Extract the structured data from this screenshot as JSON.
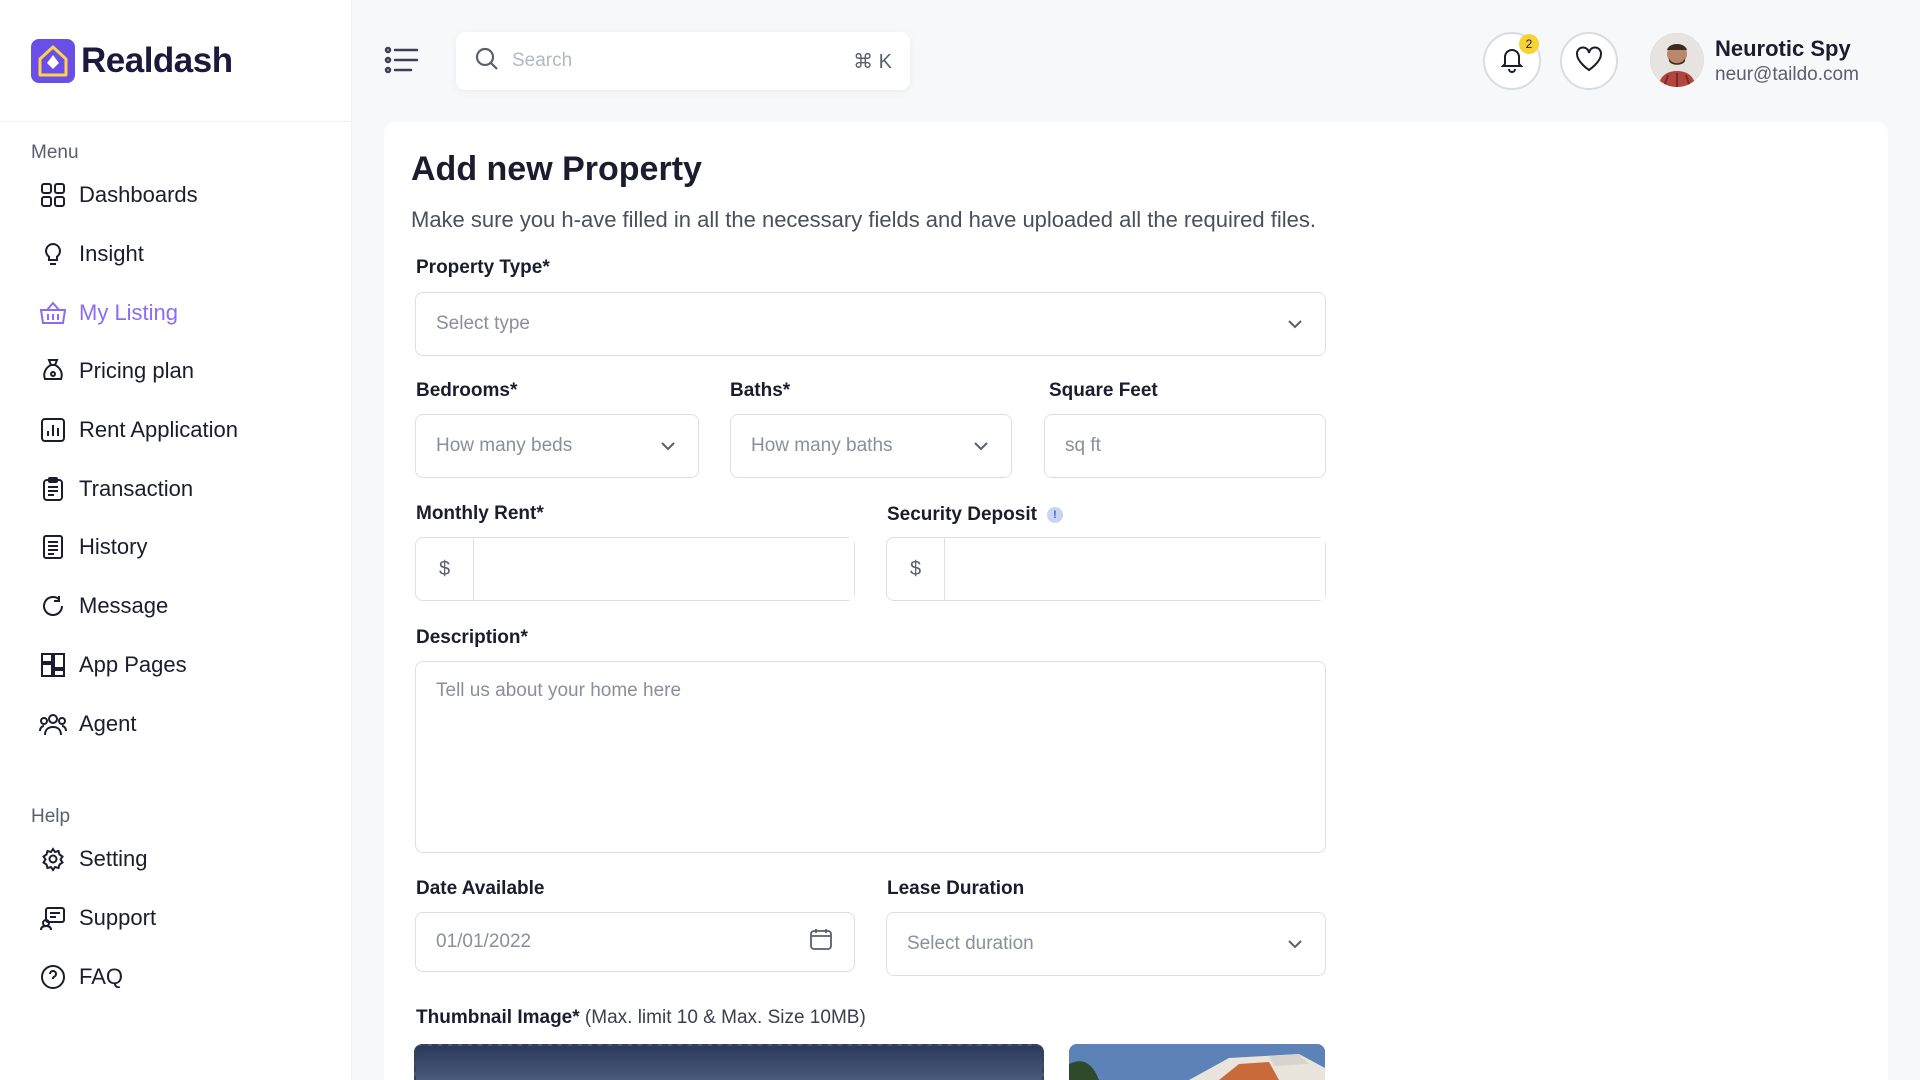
{
  "brand": {
    "name": "Realdash"
  },
  "sidebar": {
    "menu_title": "Menu",
    "items": [
      {
        "label": "Dashboards",
        "icon": "grid-icon"
      },
      {
        "label": "Insight",
        "icon": "lightbulb-icon"
      },
      {
        "label": "My Listing",
        "icon": "basket-icon",
        "active": true
      },
      {
        "label": "Pricing plan",
        "icon": "money-bag-icon"
      },
      {
        "label": "Rent Application",
        "icon": "bar-chart-icon"
      },
      {
        "label": "Transaction",
        "icon": "clipboard-icon"
      },
      {
        "label": "History",
        "icon": "document-icon"
      },
      {
        "label": "Message",
        "icon": "chat-icon"
      },
      {
        "label": "App Pages",
        "icon": "layout-icon"
      },
      {
        "label": "Agent",
        "icon": "users-icon"
      }
    ],
    "help_title": "Help",
    "help_items": [
      {
        "label": "Setting",
        "icon": "gear-icon"
      },
      {
        "label": "Support",
        "icon": "support-icon"
      },
      {
        "label": "FAQ",
        "icon": "question-icon"
      }
    ]
  },
  "topbar": {
    "search_placeholder": "Search",
    "shortcut": "⌘ K",
    "notification_count": "2",
    "user": {
      "name": "Neurotic Spy",
      "email": "neur@taildo.com"
    }
  },
  "form": {
    "title": "Add new Property",
    "subtitle": "Make sure you h-ave filled in all the necessary fields and have uploaded all the required files.",
    "property_type": {
      "label": "Property Type*",
      "placeholder": "Select type"
    },
    "bedrooms": {
      "label": "Bedrooms*",
      "placeholder": "How many beds"
    },
    "baths": {
      "label": "Baths*",
      "placeholder": "How many baths"
    },
    "square_feet": {
      "label": "Square Feet",
      "placeholder": "sq ft"
    },
    "monthly_rent": {
      "label": "Monthly Rent*",
      "currency": "$"
    },
    "security_deposit": {
      "label": "Security Deposit",
      "currency": "$",
      "info": "!"
    },
    "description": {
      "label": "Description*",
      "placeholder": "Tell us about your home here"
    },
    "date_available": {
      "label": "Date Available",
      "value": "01/01/2022"
    },
    "lease_duration": {
      "label": "Lease Duration",
      "placeholder": "Select duration"
    },
    "thumbnail": {
      "label": "Thumbnail Image*",
      "note": "(Max. limit 10 & Max. Size 10MB)"
    }
  },
  "colors": {
    "accent": "#8c6cf0",
    "brand": "#6a4ee8",
    "badge": "#f7d232"
  }
}
